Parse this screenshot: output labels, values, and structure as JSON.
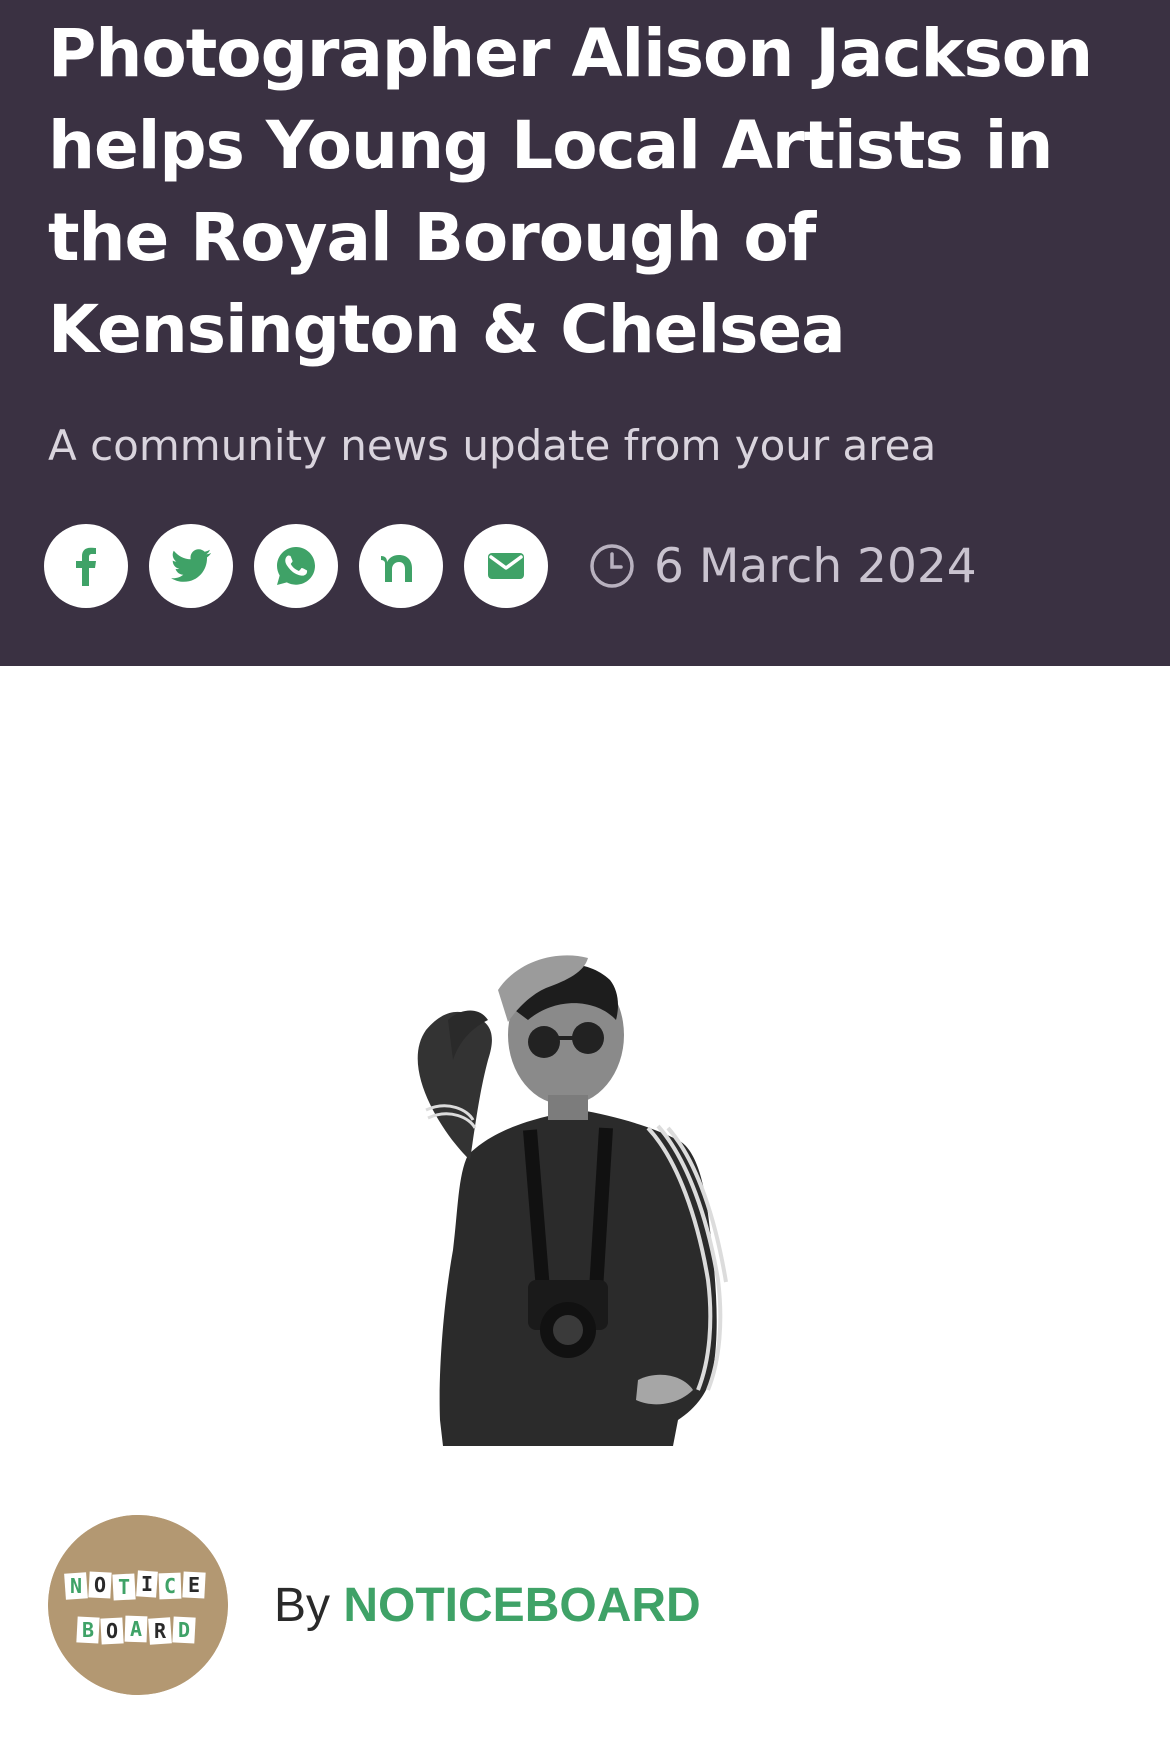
{
  "article": {
    "headline": "Photographer Alison Jackson helps Young Local Artists in the Royal Borough of Kensington & Chelsea",
    "subtitle": "A community news update from your area",
    "date": "6 March 2024",
    "byline_prefix": "By",
    "author": "NOTICEBOARD"
  },
  "avatar_logo": {
    "line1": [
      "N",
      "O",
      "T",
      "I",
      "C",
      "E"
    ],
    "line2": [
      "B",
      "O",
      "A",
      "R",
      "D"
    ]
  },
  "share_buttons": [
    {
      "icon": "facebook-icon"
    },
    {
      "icon": "twitter-icon"
    },
    {
      "icon": "whatsapp-icon"
    },
    {
      "icon": "nextdoor-icon"
    },
    {
      "icon": "email-icon"
    }
  ],
  "colors": {
    "header_bg": "#3a3142",
    "accent_green": "#3fa267",
    "text_white": "#ffffff"
  }
}
